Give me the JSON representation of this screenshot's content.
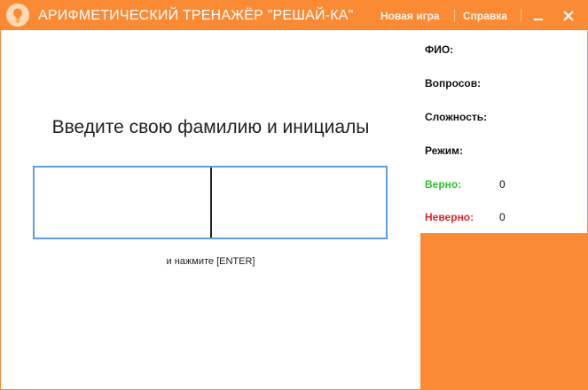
{
  "window": {
    "title": "АРИФМЕТИЧЕСКИЙ ТРЕНАЖЁР \"РЕШАЙ-КА\"",
    "menu": {
      "new_game": "Новая игра",
      "help": "Справка"
    }
  },
  "main": {
    "prompt": "Введите свою фамилию и инициалы",
    "input_value": "",
    "hint": "и нажмите [ENTER]"
  },
  "info": {
    "fio_label": "ФИО:",
    "questions_label": "Вопросов:",
    "difficulty_label": "Сложность:",
    "mode_label": "Режим:",
    "correct_label": "Верно:",
    "correct_value": "0",
    "wrong_label": "Неверно:",
    "wrong_value": "0"
  },
  "colors": {
    "accent": "#fb8a34",
    "correct": "#2fbf2f",
    "wrong": "#d9262b",
    "input_border": "#5b9ee1"
  },
  "icons": {
    "app": "lightbulb-icon",
    "minimize": "minimize-icon",
    "close": "close-icon"
  }
}
